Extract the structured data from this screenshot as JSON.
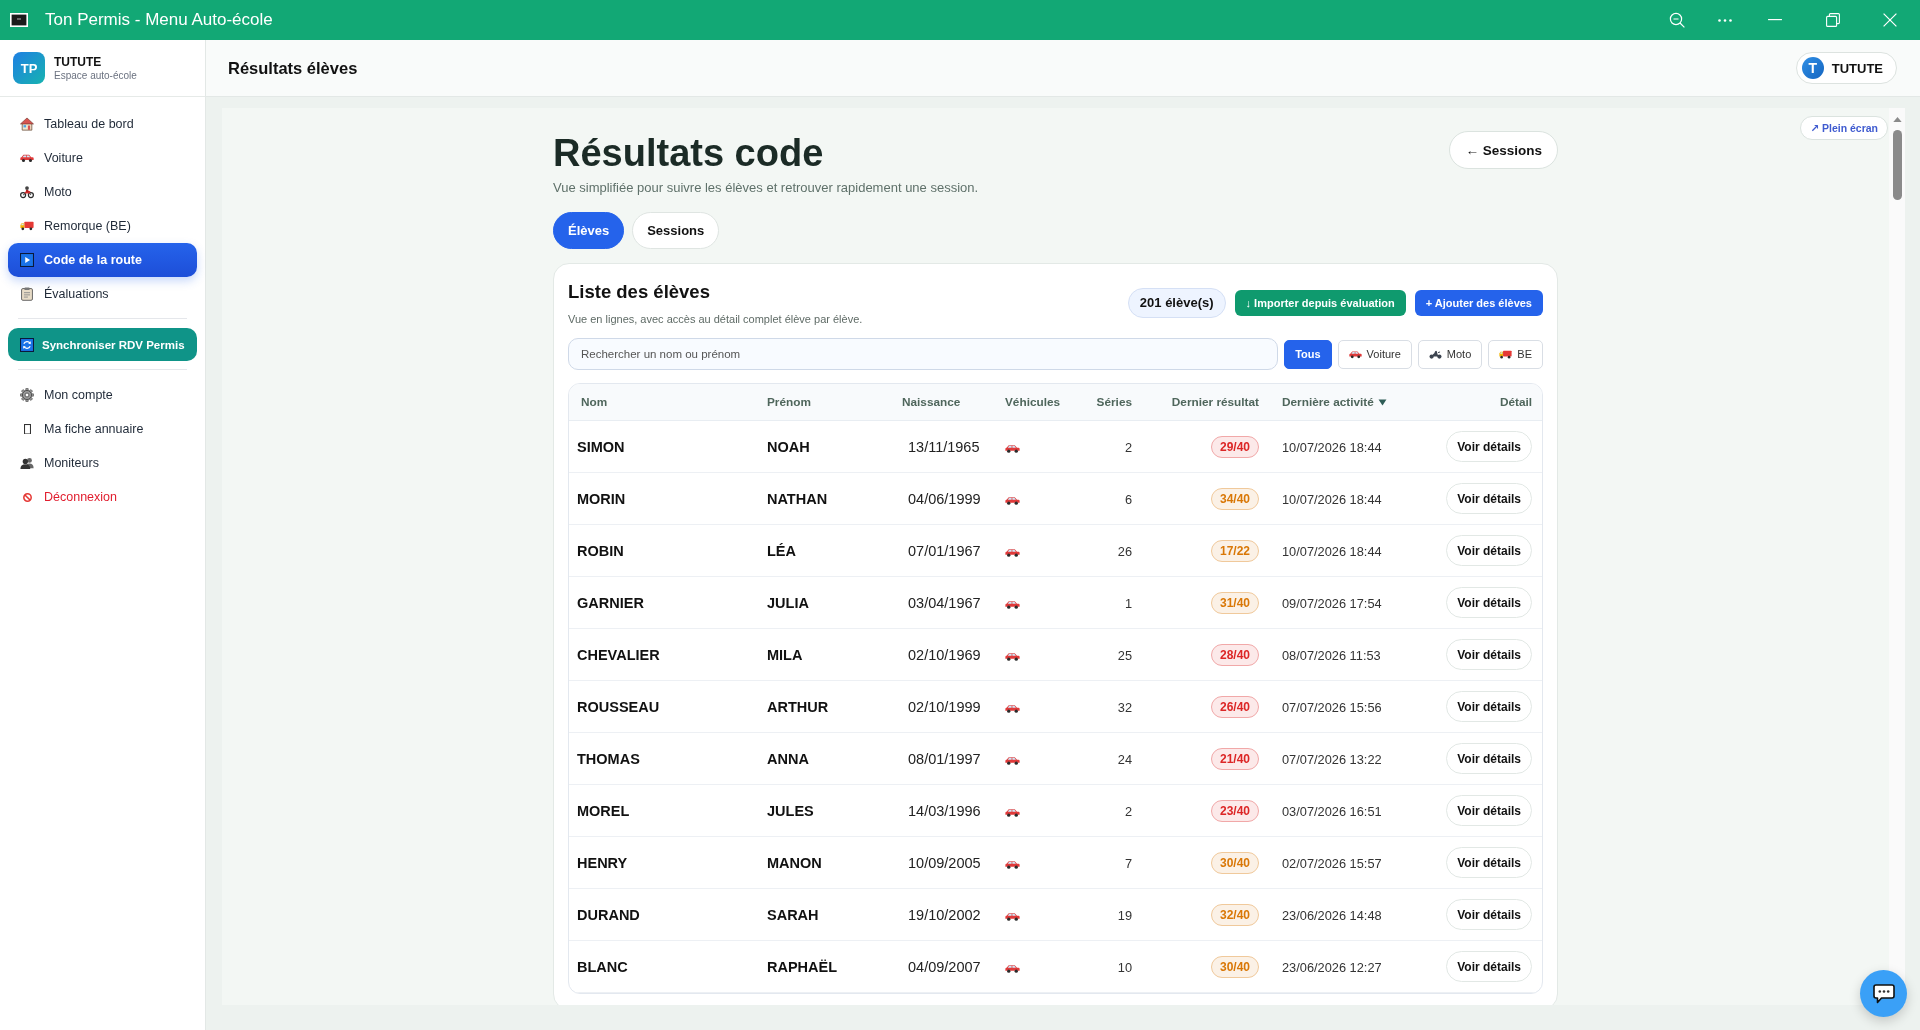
{
  "window": {
    "title": "Ton Permis - Menu Auto-école"
  },
  "sidebar": {
    "brand": {
      "logo": "TP",
      "name": "TUTUTE",
      "subtitle": "Espace auto-école"
    },
    "nav": [
      {
        "label": "Tableau de bord",
        "selected": false
      },
      {
        "label": "Voiture",
        "selected": false
      },
      {
        "label": "Moto",
        "selected": false
      },
      {
        "label": "Remorque (BE)",
        "selected": false
      },
      {
        "label": "Code de la route",
        "selected": true
      },
      {
        "label": "Évaluations",
        "selected": false
      }
    ],
    "sync_button": {
      "label": "Synchroniser RDV Permis"
    },
    "account": [
      {
        "label": "Mon compte",
        "danger": false
      },
      {
        "label": "Ma fiche annuaire",
        "danger": false
      },
      {
        "label": "Moniteurs",
        "danger": false
      },
      {
        "label": "Déconnexion",
        "danger": true
      }
    ]
  },
  "header": {
    "title": "Résultats élèves",
    "user": {
      "initial": "T",
      "name": "TUTUTE"
    }
  },
  "page": {
    "fullscreen_button": "↗ Plein écran",
    "title": "Résultats code",
    "subtitle": "Vue simplifiée pour suivre les élèves et retrouver rapidement une session.",
    "back_button": "← Sessions",
    "tabs": [
      {
        "label": "Élèves",
        "selected": true
      },
      {
        "label": "Sessions",
        "selected": false
      }
    ],
    "card": {
      "title": "Liste des élèves",
      "subtitle": "Vue en lignes, avec accès au détail complet élève par élève.",
      "count": "201 élève(s)",
      "import_button": "↓ Importer depuis évaluation",
      "add_button": "+ Ajouter des élèves",
      "search": {
        "placeholder": "Rechercher un nom ou prénom"
      },
      "filters": [
        {
          "label": "Tous",
          "selected": true,
          "kind": "all"
        },
        {
          "label": "Voiture",
          "selected": false,
          "kind": "car"
        },
        {
          "label": "Moto",
          "selected": false,
          "kind": "moto"
        },
        {
          "label": "BE",
          "selected": false,
          "kind": "trailer"
        }
      ],
      "table": {
        "columns": [
          {
            "label": "Nom",
            "sorted": false
          },
          {
            "label": "Prénom",
            "sorted": false
          },
          {
            "label": "Naissance",
            "sorted": false
          },
          {
            "label": "Véhicules",
            "sorted": false
          },
          {
            "label": "Séries",
            "sorted": false
          },
          {
            "label": "Dernier résultat",
            "sorted": false
          },
          {
            "label": "Dernière activité",
            "sorted": true
          },
          {
            "label": "Détail",
            "sorted": false
          }
        ],
        "rows": [
          {
            "last_name": "SIMON",
            "first_name": "NOAH",
            "birth_date": "13/11/1965",
            "vehicles": [
              {
                "kind": "car"
              }
            ],
            "series": "2",
            "result": "29/40",
            "color": "#dc2626",
            "last_activity": "10/07/2026 18:44",
            "action": "Voir détails"
          },
          {
            "last_name": "MORIN",
            "first_name": "NATHAN",
            "birth_date": "04/06/1999",
            "vehicles": [
              {
                "kind": "car"
              }
            ],
            "series": "6",
            "result": "34/40",
            "color": "#d97706",
            "last_activity": "10/07/2026 18:44",
            "action": "Voir détails"
          },
          {
            "last_name": "ROBIN",
            "first_name": "LÉA",
            "birth_date": "07/01/1967",
            "vehicles": [
              {
                "kind": "car"
              }
            ],
            "series": "26",
            "result": "17/22",
            "color": "#d97706",
            "last_activity": "10/07/2026 18:44",
            "action": "Voir détails"
          },
          {
            "last_name": "GARNIER",
            "first_name": "JULIA",
            "birth_date": "03/04/1967",
            "vehicles": [
              {
                "kind": "car"
              }
            ],
            "series": "1",
            "result": "31/40",
            "color": "#d97706",
            "last_activity": "09/07/2026 17:54",
            "action": "Voir détails"
          },
          {
            "last_name": "CHEVALIER",
            "first_name": "MILA",
            "birth_date": "02/10/1969",
            "vehicles": [
              {
                "kind": "car"
              }
            ],
            "series": "25",
            "result": "28/40",
            "color": "#dc2626",
            "last_activity": "08/07/2026 11:53",
            "action": "Voir détails"
          },
          {
            "last_name": "ROUSSEAU",
            "first_name": "ARTHUR",
            "birth_date": "02/10/1999",
            "vehicles": [
              {
                "kind": "car"
              }
            ],
            "series": "32",
            "result": "26/40",
            "color": "#dc2626",
            "last_activity": "07/07/2026 15:56",
            "action": "Voir détails"
          },
          {
            "last_name": "THOMAS",
            "first_name": "ANNA",
            "birth_date": "08/01/1997",
            "vehicles": [
              {
                "kind": "car"
              }
            ],
            "series": "24",
            "result": "21/40",
            "color": "#dc2626",
            "last_activity": "07/07/2026 13:22",
            "action": "Voir détails"
          },
          {
            "last_name": "MOREL",
            "first_name": "JULES",
            "birth_date": "14/03/1996",
            "vehicles": [
              {
                "kind": "car"
              }
            ],
            "series": "2",
            "result": "23/40",
            "color": "#dc2626",
            "last_activity": "03/07/2026 16:51",
            "action": "Voir détails"
          },
          {
            "last_name": "HENRY",
            "first_name": "MANON",
            "birth_date": "10/09/2005",
            "vehicles": [
              {
                "kind": "car"
              }
            ],
            "series": "7",
            "result": "30/40",
            "color": "#d97706",
            "last_activity": "02/07/2026 15:57",
            "action": "Voir détails"
          },
          {
            "last_name": "DURAND",
            "first_name": "SARAH",
            "birth_date": "19/10/2002",
            "vehicles": [
              {
                "kind": "car"
              }
            ],
            "series": "19",
            "result": "32/40",
            "color": "#d97706",
            "last_activity": "23/06/2026 14:48",
            "action": "Voir détails"
          },
          {
            "last_name": "BLANC",
            "first_name": "RAPHAËL",
            "birth_date": "04/09/2007",
            "vehicles": [
              {
                "kind": "car"
              }
            ],
            "series": "10",
            "result": "30/40",
            "color": "#d97706",
            "last_activity": "23/06/2026 12:27",
            "action": "Voir détails"
          }
        ]
      }
    }
  }
}
